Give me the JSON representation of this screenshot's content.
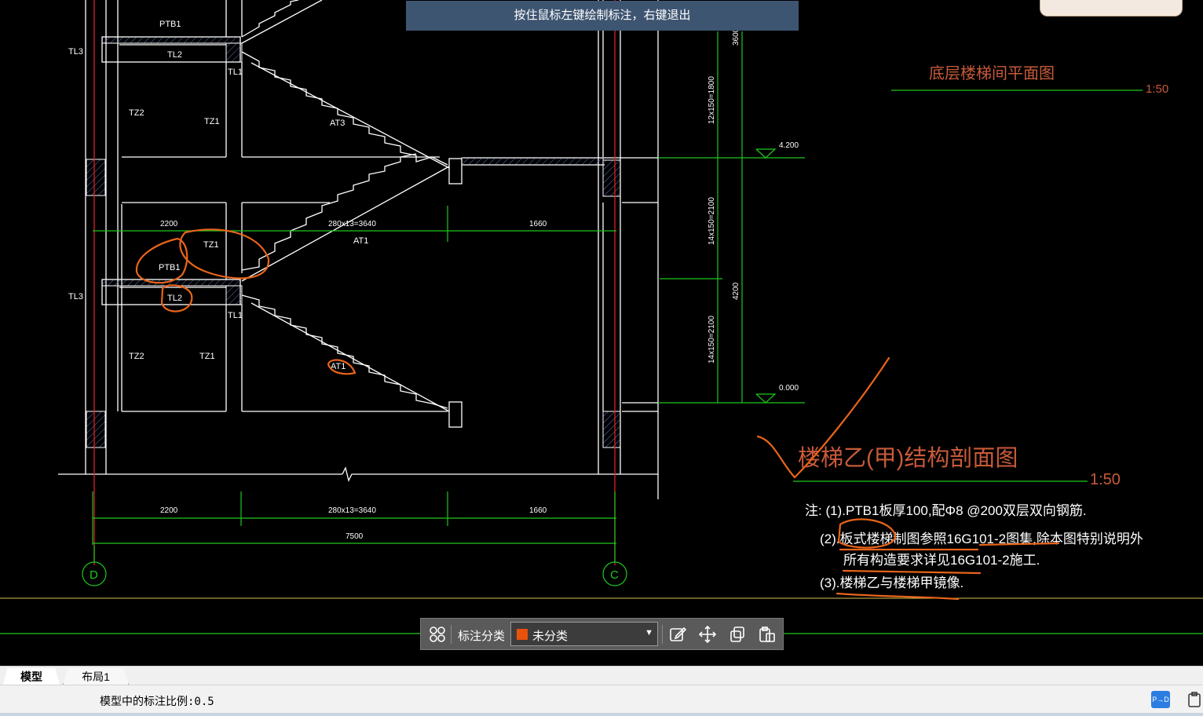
{
  "hint_text": "按住鼠标左键绘制标注，右键退出",
  "drawing": {
    "labels": {
      "ptb1_top": "PTB1",
      "tl2_top": "TL2",
      "tl3_top": "TL3",
      "tl1_top": "TL1",
      "tz2_top": "TZ2",
      "tz1_top": "TZ1",
      "at3": "AT3",
      "dim_2200_mid": "2200",
      "dim_280_mid": "280x13=3640",
      "dim_1660_mid": "1660",
      "at1_mid": "AT1",
      "tz1_mid": "TZ1",
      "ptb1_mid": "PTB1",
      "tl3_mid": "TL3",
      "tl2_mid": "TL2",
      "tl1_mid": "TL1",
      "tz2_low": "TZ2",
      "tz1_low": "TZ1",
      "at1_low": "AT1",
      "dim_2200_bot": "2200",
      "dim_280_bot": "280x13=3640",
      "dim_1660_bot": "1660",
      "dim_7500": "7500",
      "axis_d": "D",
      "axis_c": "C",
      "vdim_3600": "3600",
      "vdim_12x150": "12x150=1800",
      "vdim_14x150_a": "14x150=2100",
      "vdim_4200": "4200",
      "vdim_14x150_b": "14x150=2100",
      "elev_4200": "4.200",
      "elev_0000": "0.000",
      "plan_title": "底层楼梯间平面图",
      "plan_scale": "1:50",
      "section_title": "楼梯乙(甲)结构剖面图",
      "section_scale": "1:50",
      "note1": "注: (1).PTB1板厚100,配Φ8 @200双层双向钢筋.",
      "note2": "(2).板式楼梯制图参照16G101-2图集,除本图特别说明外",
      "note2b": "所有构造要求详见16G101-2施工.",
      "note3": "(3).楼梯乙与楼梯甲镜像."
    }
  },
  "toolbar": {
    "category_label": "标注分类",
    "category_value": "未分类",
    "category_color": "#e8520c",
    "icons": [
      "grid-icon",
      "edit-icon",
      "move-icon",
      "copy-icon",
      "paste-icon"
    ]
  },
  "tabs": {
    "model": "模型",
    "layout": "布局1"
  },
  "status": {
    "scale_text": "模型中的标注比例:0.5",
    "right_icon": "P→D"
  }
}
